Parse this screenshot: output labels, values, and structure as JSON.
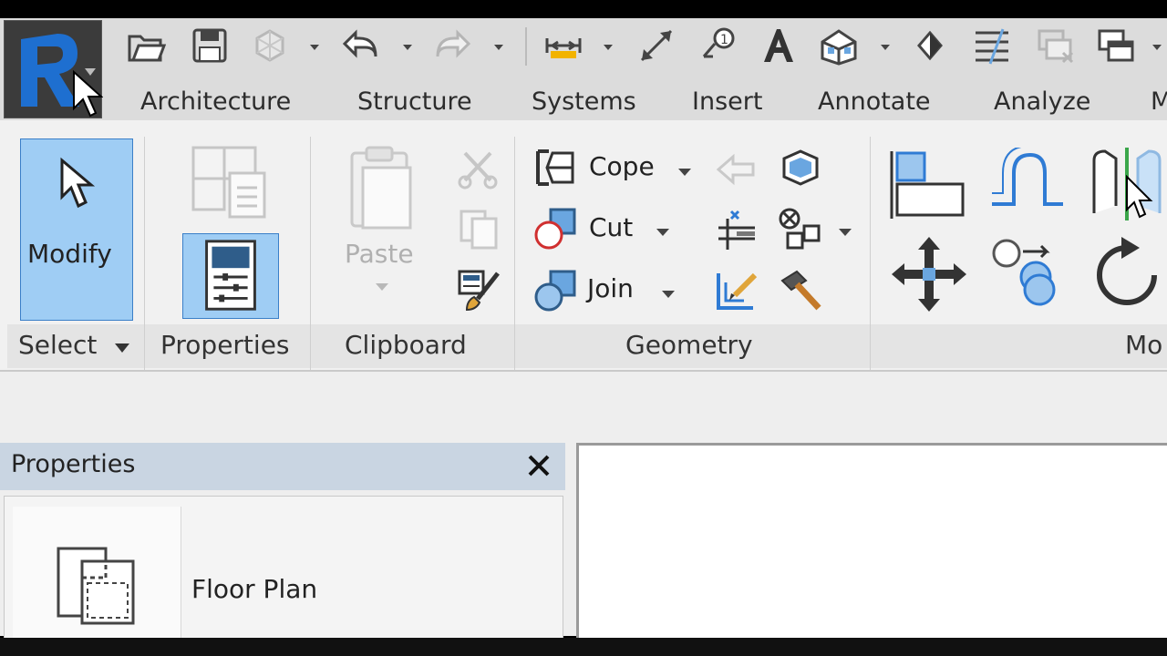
{
  "app": {
    "logo_letter": "R",
    "accent": "#1e6fd0"
  },
  "quick_access": {
    "items": [
      "open-icon",
      "save-icon",
      "sync-icon",
      "undo-icon",
      "redo-icon",
      "measure-icon",
      "align-dimension-icon",
      "tag-icon",
      "text-icon",
      "3d-view-icon",
      "section-icon",
      "thin-lines-icon",
      "close-hidden-icon",
      "switch-windows-icon"
    ]
  },
  "tabs": [
    "Architecture",
    "Structure",
    "Systems",
    "Insert",
    "Annotate",
    "Analyze",
    "M"
  ],
  "ribbon": {
    "select": {
      "button_label": "Modify",
      "panel_label": "Select"
    },
    "properties": {
      "panel_label": "Properties"
    },
    "clipboard": {
      "paste_label": "Paste",
      "panel_label": "Clipboard"
    },
    "geometry": {
      "cope": "Cope",
      "cut": "Cut",
      "join": "Join",
      "panel_label": "Geometry"
    },
    "modify": {
      "panel_label": "Mo"
    }
  },
  "properties_palette": {
    "title": "Properties",
    "type_name": "Floor Plan"
  }
}
